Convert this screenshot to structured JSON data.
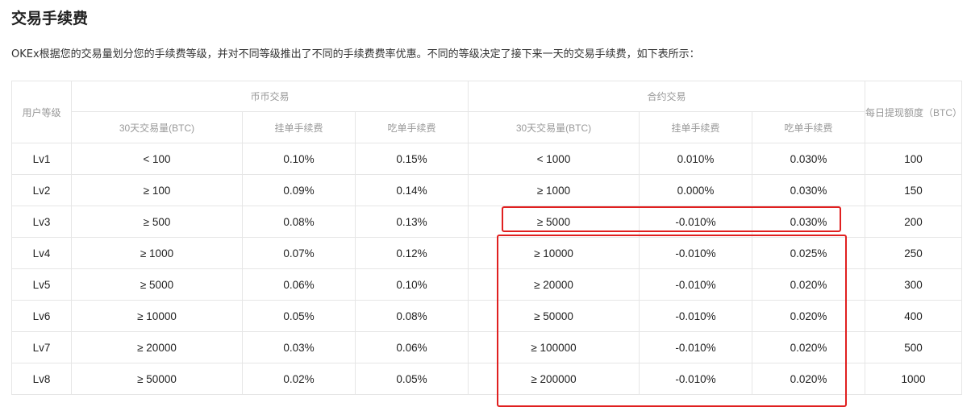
{
  "title": "交易手续费",
  "intro": "OKEx根据您的交易量划分您的手续费等级，并对不同等级推出了不同的手续费费率优惠。不同的等级决定了接下来一天的交易手续费，如下表所示：",
  "table": {
    "headers": {
      "level": "用户等级",
      "spot": "币币交易",
      "contract": "合约交易",
      "withdraw": "每日提现额度（BTC）",
      "volume": "30天交易量(BTC)",
      "maker": "挂单手续费",
      "taker": "吃单手续费"
    },
    "rows": [
      [
        "Lv1",
        "< 100",
        "0.10%",
        "0.15%",
        "< 1000",
        "0.010%",
        "0.030%",
        "100"
      ],
      [
        "Lv2",
        "≥ 100",
        "0.09%",
        "0.14%",
        "≥ 1000",
        "0.000%",
        "0.030%",
        "150"
      ],
      [
        "Lv3",
        "≥ 500",
        "0.08%",
        "0.13%",
        "≥ 5000",
        "-0.010%",
        "0.030%",
        "200"
      ],
      [
        "Lv4",
        "≥ 1000",
        "0.07%",
        "0.12%",
        "≥ 10000",
        "-0.010%",
        "0.025%",
        "250"
      ],
      [
        "Lv5",
        "≥ 5000",
        "0.06%",
        "0.10%",
        "≥ 20000",
        "-0.010%",
        "0.020%",
        "300"
      ],
      [
        "Lv6",
        "≥ 10000",
        "0.05%",
        "0.08%",
        "≥ 50000",
        "-0.010%",
        "0.020%",
        "400"
      ],
      [
        "Lv7",
        "≥ 20000",
        "0.03%",
        "0.06%",
        "≥ 100000",
        "-0.010%",
        "0.020%",
        "500"
      ],
      [
        "Lv8",
        "≥ 50000",
        "0.02%",
        "0.05%",
        "≥ 200000",
        "-0.010%",
        "0.020%",
        "1000"
      ]
    ]
  },
  "highlight_color": "#e02020"
}
